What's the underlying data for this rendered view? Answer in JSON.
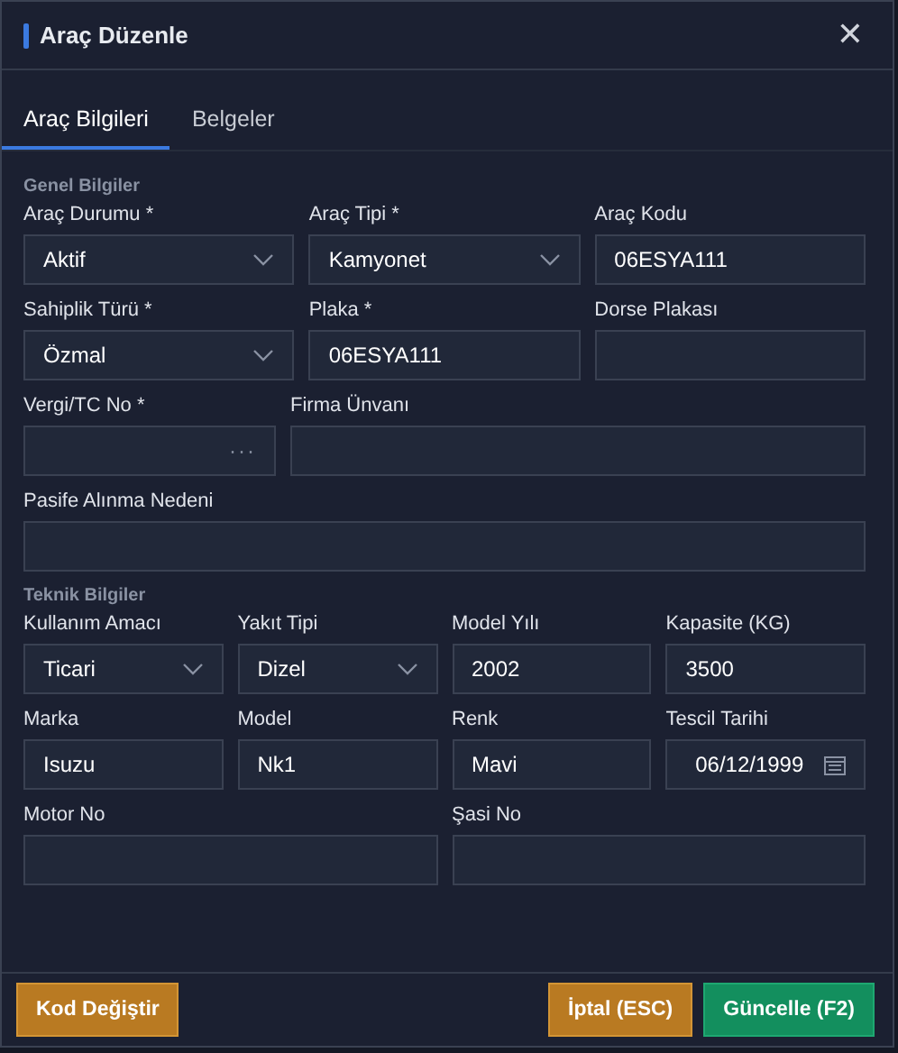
{
  "window": {
    "title": "Araç Düzenle",
    "close": "✕"
  },
  "tabs": [
    {
      "label": "Araç Bilgileri",
      "selected": true
    },
    {
      "label": "Belgeler",
      "selected": false
    }
  ],
  "sections": [
    {
      "title": "Genel Bilgiler",
      "rows": [
        [
          {
            "label": "Araç Durumu *",
            "kind": "select",
            "value": "Aktif"
          },
          {
            "label": "Araç Tipi *",
            "kind": "select",
            "value": "Kamyonet"
          },
          {
            "label": "Araç Kodu",
            "kind": "text",
            "value": "06ESYA111"
          }
        ],
        [
          {
            "label": "Sahiplik Türü *",
            "kind": "select",
            "value": "Özmal"
          },
          {
            "label": "Plaka *",
            "kind": "text",
            "value": "06ESYA111"
          },
          {
            "label": "Dorse Plakası",
            "kind": "text"
          }
        ],
        [
          {
            "label": "Vergi/TC No *",
            "kind": "lookup",
            "button": "···"
          },
          {
            "label": "Firma Ünvanı",
            "kind": "text"
          }
        ],
        [
          {
            "label": "Pasife Alınma Nedeni",
            "kind": "text"
          }
        ]
      ]
    },
    {
      "title": "Teknik Bilgiler",
      "rows": [
        [
          {
            "label": "Kullanım Amacı",
            "kind": "select",
            "value": "Ticari"
          },
          {
            "label": "Yakıt Tipi",
            "kind": "select",
            "value": "Dizel"
          },
          {
            "label": "Model Yılı",
            "kind": "text",
            "value": "2002"
          },
          {
            "label": "Kapasite (KG)",
            "kind": "text",
            "value": "3500"
          }
        ],
        [
          {
            "label": "Marka",
            "kind": "text",
            "value": "Isuzu"
          },
          {
            "label": "Model",
            "kind": "text",
            "value": "Nk1"
          },
          {
            "label": "Renk",
            "kind": "text",
            "value": "Mavi"
          },
          {
            "label": "Tescil Tarihi",
            "kind": "date",
            "value": "06/12/1999"
          }
        ]
      ],
      "wide_fields": [
        {
          "label": "Motor No",
          "kind": "text"
        },
        {
          "label": "Şasi No",
          "kind": "text"
        }
      ]
    }
  ],
  "footer": {
    "left": [
      {
        "label": "Kod Değiştir",
        "kind": "warning"
      }
    ],
    "right": [
      {
        "label": "İptal (ESC)",
        "kind": "warning"
      },
      {
        "label": "Güncelle (F2)",
        "kind": "success"
      }
    ]
  }
}
